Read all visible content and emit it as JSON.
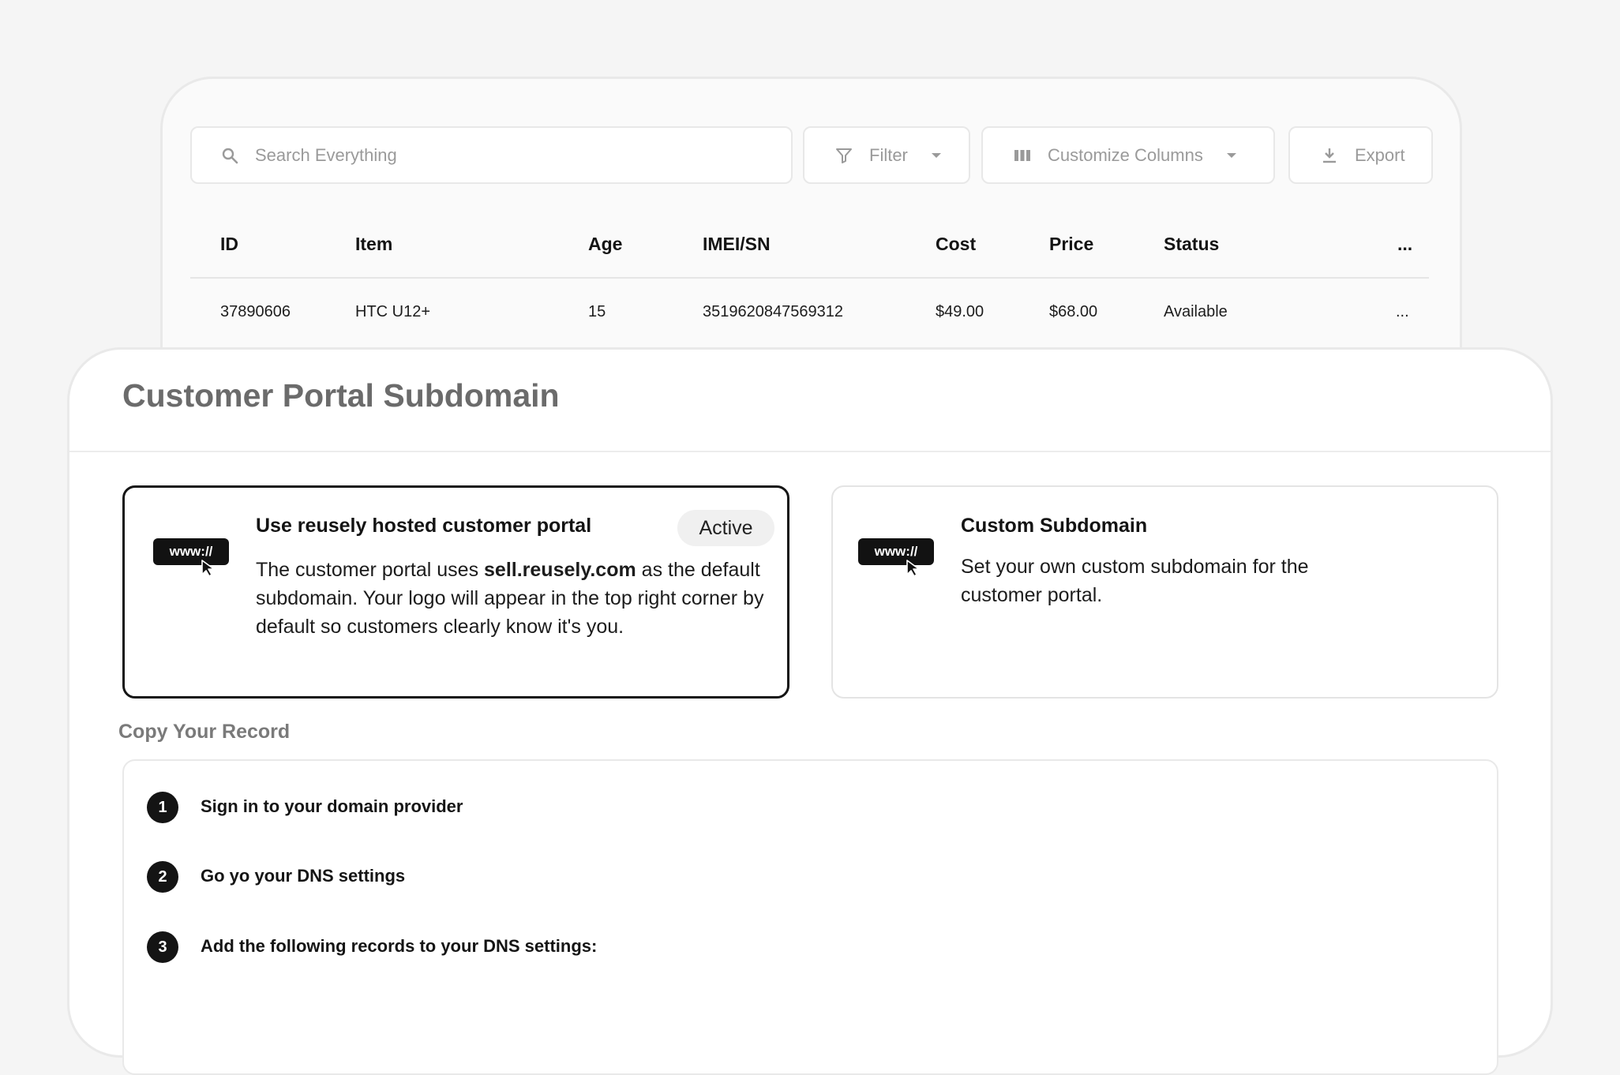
{
  "toolbar": {
    "search_placeholder": "Search Everything",
    "filter_label": "Filter",
    "columns_label": "Customize Columns",
    "export_label": "Export"
  },
  "table": {
    "headers": [
      "ID",
      "Item",
      "Age",
      "IMEI/SN",
      "Cost",
      "Price",
      "Status",
      "..."
    ],
    "rows": [
      [
        "37890606",
        "HTC U12+",
        "15",
        "3519620847569312",
        "$49.00",
        "$68.00",
        "Available",
        "..."
      ]
    ]
  },
  "portal": {
    "title": "Customer Portal Subdomain",
    "url_icon_text": "www://",
    "options": [
      {
        "title": "Use reusely hosted customer portal",
        "badge": "Active",
        "body_before": "The customer portal uses ",
        "body_bold": "sell.reusely.com",
        "body_after": " as the default subdomain. Your logo will appear in the top right corner by default so customers clearly know it's you."
      },
      {
        "title": "Custom Subdomain",
        "body": "Set your own custom subdomain for the customer portal."
      }
    ]
  },
  "record": {
    "title": "Copy Your Record",
    "steps": [
      {
        "num": "1",
        "text": "Sign in to your domain provider"
      },
      {
        "num": "2",
        "text": "Go yo your DNS settings"
      },
      {
        "num": "3",
        "text": "Add the following records to your DNS settings:"
      }
    ]
  }
}
